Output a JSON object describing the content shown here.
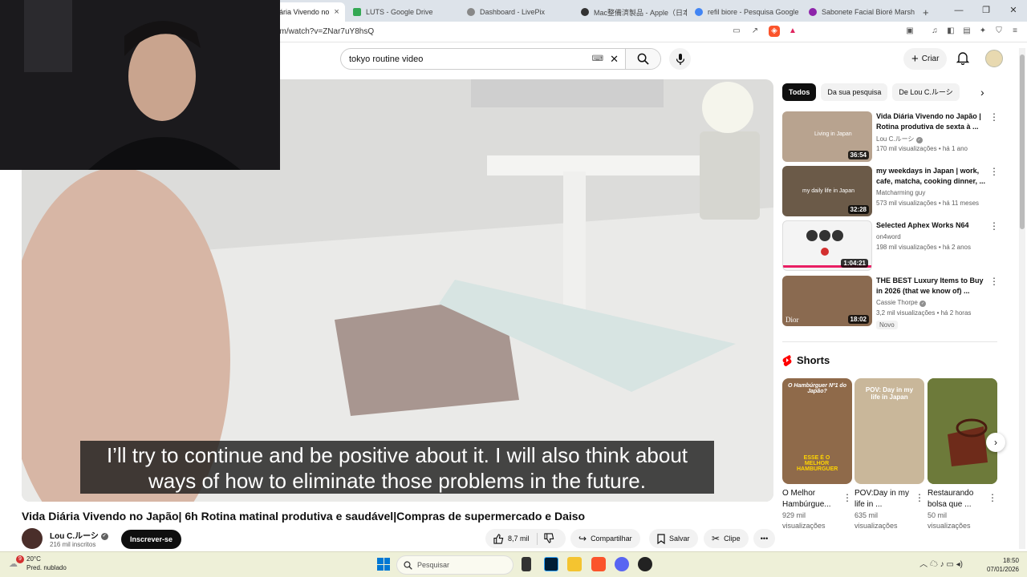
{
  "browser": {
    "tabs": [
      {
        "label": "ária Vivendo no",
        "active": true,
        "color": "#ff0000"
      },
      {
        "label": "LUTS - Google Drive",
        "color": "#34a853"
      },
      {
        "label": "Dashboard - LivePix",
        "color": "#888888"
      },
      {
        "label": "Mac整備済製品 - Apple（日本",
        "color": "#333333"
      },
      {
        "label": "refil biore - Pesquisa Google",
        "color": "#4285f4"
      },
      {
        "label": "Sabonete Facial Bioré Marshm",
        "color": "#8e24aa"
      }
    ],
    "new_tab": "+",
    "tab_close": "×",
    "url": "om/watch?v=ZNar7uY8hsQ",
    "window_controls": {
      "minimize": "—",
      "restore": "❐",
      "close": "✕"
    }
  },
  "youtube": {
    "search_value": "tokyo routine video",
    "keyboard_icon": "⌨",
    "clear_icon": "✕",
    "create_label": "Criar"
  },
  "player": {
    "caption_line1": "I’ll try to continue and be positive about it. I will also think about",
    "caption_line2": "ways of how to eliminate those problems in the future."
  },
  "video": {
    "title": "Vida Diária Vivendo no Japão| 6h Rotina matinal produtiva e saudável|Compras de supermercado e Daiso",
    "channel": "Lou C.ルーシ",
    "subscribers": "216 mil inscritos",
    "subscribe_label": "Inscrever-se",
    "likes": "8,7 mil",
    "share_label": "Compartilhar",
    "save_label": "Salvar",
    "clip_label": "Clipe",
    "more": "•••"
  },
  "chips": [
    "Todos",
    "Da sua pesquisa",
    "De Lou C.ルーシ"
  ],
  "recommendations": [
    {
      "title": "Vida Diária Vivendo no Japão | Rotina produtiva de sexta à ...",
      "channel": "Lou C.ルーシ",
      "verified": true,
      "meta": "170 mil visualizações • há 1 ano",
      "duration": "36:54",
      "overlay": "Living in Japan",
      "color": "#b8a38f"
    },
    {
      "title": "my weekdays in Japan | work, cafe, matcha, cooking dinner, ...",
      "channel": "Matcharming guy",
      "verified": false,
      "meta": "573 mil visualizações • há 11 meses",
      "duration": "32:28",
      "overlay": "my daily life in Japan",
      "color": "#6b5a48"
    },
    {
      "title": "Selected Aphex Works N64",
      "channel": "on4word",
      "verified": false,
      "meta": "198 mil visualizações • há 2 anos",
      "duration": "1:04:21",
      "overlay": "",
      "color": "#f4f4f4"
    },
    {
      "title": "THE BEST Luxury Items to Buy in 2026 (that we know of) ...",
      "channel": "Cassie Thorpe",
      "verified": true,
      "meta": "3,2 mil visualizações • há 2 horas",
      "duration": "18:02",
      "overlay": "Dior",
      "color": "#8a6a50",
      "badge": "Novo"
    }
  ],
  "shorts": {
    "heading": "Shorts",
    "items": [
      {
        "title": "O Melhor Hambúrgue...",
        "views": "929 mil visualizações",
        "overlay": "ESSE É O MELHOR HAMBURGUER",
        "top": "O Hambúrguer Nº1 do Japão?",
        "color": "#8f6a4a"
      },
      {
        "title": "POV:Day in my life in ...",
        "views": "635 mil visualizações",
        "overlay": "POV: Day in my life in Japan",
        "top": "",
        "color": "#c9b79a"
      },
      {
        "title": "Restaurando bolsa que ...",
        "views": "50 mil visualizações",
        "overlay": "",
        "top": "",
        "color": "#6d7a3a"
      }
    ]
  },
  "taskbar": {
    "temperature": "20°C",
    "weather": "Pred. nublado",
    "weather_badge": "9",
    "search_placeholder": "Pesquisar",
    "time": "18:50",
    "date": "07/01/2026"
  }
}
